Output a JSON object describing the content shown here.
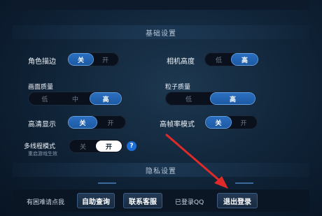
{
  "sections": {
    "basic_title": "基础设置",
    "privacy_title": "隐私设置"
  },
  "settings": {
    "outline": {
      "label": "角色描边",
      "options": [
        "关",
        "开"
      ],
      "selected": 0
    },
    "camera_height": {
      "label": "相机高度",
      "options": [
        "低",
        "高"
      ],
      "selected": 1
    },
    "quality": {
      "label": "画面质量",
      "options": [
        "低",
        "中",
        "高"
      ],
      "selected": 2
    },
    "particle": {
      "label": "粒子质量",
      "options": [
        "低",
        "高"
      ],
      "selected": 1
    },
    "hd": {
      "label": "高清显示",
      "options": [
        "关",
        "开"
      ],
      "selected": 0
    },
    "high_fps": {
      "label": "高帧率模式",
      "options": [
        "关",
        "开"
      ],
      "selected": 0
    },
    "multithread": {
      "label": "多线程模式",
      "sublabel": "重启游戏生效",
      "options": [
        "关",
        "开"
      ],
      "selected": 1
    }
  },
  "help_icon": {
    "glyph": "?",
    "icon": "help-icon"
  },
  "footer": {
    "question_text": "有困难请点我",
    "self_query": "自助查询",
    "contact_support": "联系客服",
    "logged_in": "已登录QQ",
    "logout": "退出登录"
  },
  "colors": {
    "accent_blue": "#1d5aa3",
    "arrow_red": "#e02a2a"
  }
}
